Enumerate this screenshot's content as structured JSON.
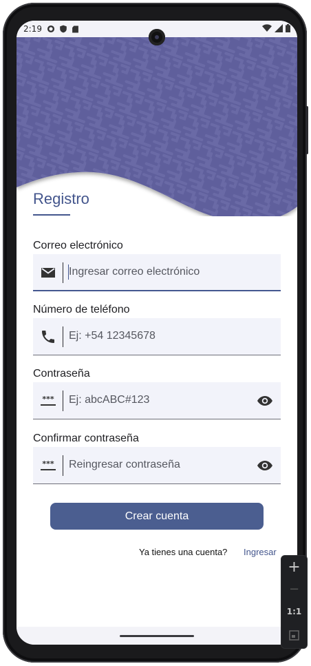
{
  "status_bar": {
    "time": "2:19"
  },
  "colors": {
    "primary": "#43558c",
    "header": "#5f5f9c",
    "field_bg": "#f2f3fa"
  },
  "page": {
    "title": "Registro"
  },
  "form": {
    "email": {
      "label": "Correo electrónico",
      "placeholder": "Ingresar correo electrónico",
      "icon": "mail-icon"
    },
    "phone": {
      "label": "Número de teléfono",
      "placeholder": "Ej: +54 12345678",
      "icon": "phone-icon"
    },
    "password": {
      "label": "Contraseña",
      "placeholder": "Ej: abcABC#123",
      "icon": "password-icon"
    },
    "confirm": {
      "label": "Confirmar contraseña",
      "placeholder": "Reingresar contraseña",
      "icon": "password-icon"
    }
  },
  "actions": {
    "create_account": "Crear cuenta"
  },
  "footer": {
    "question": "Ya tienes una cuenta?",
    "login_link": "Ingresar"
  },
  "emulator_zoom": {
    "plus": "+",
    "minus": "−",
    "ratio": "1:1"
  }
}
